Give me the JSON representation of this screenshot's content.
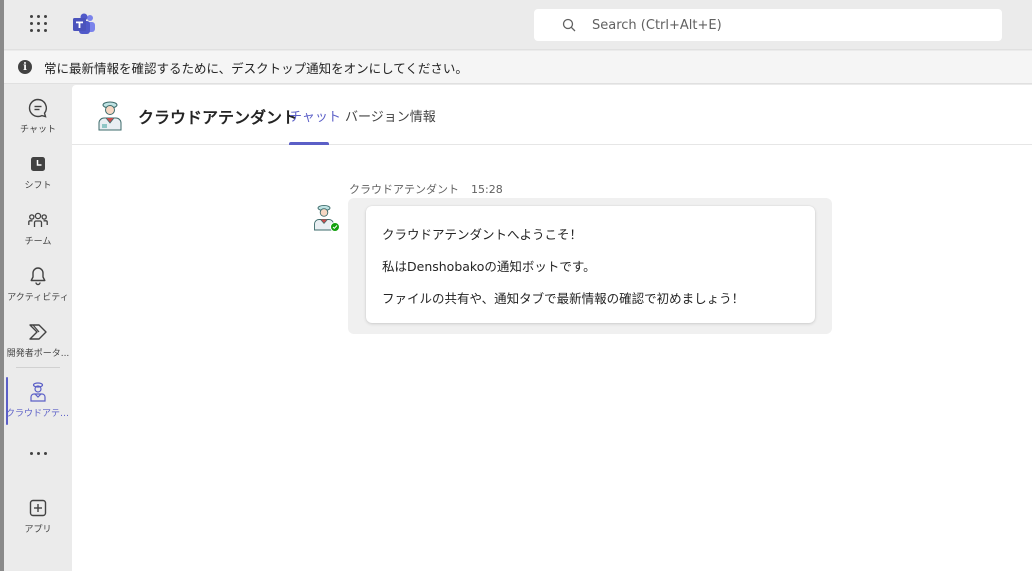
{
  "search": {
    "placeholder": "Search (Ctrl+Alt+E)"
  },
  "notification": {
    "text": "常に最新情報を確認するために、デスクトップ通知をオンにしてください。"
  },
  "rail": {
    "items": [
      {
        "label": "チャット",
        "icon": "chat-icon"
      },
      {
        "label": "シフト",
        "icon": "shifts-icon"
      },
      {
        "label": "チーム",
        "icon": "teams-icon"
      },
      {
        "label": "アクティビティ",
        "icon": "bell-icon"
      },
      {
        "label": "開発者ポータ...",
        "icon": "developer-portal-icon"
      },
      {
        "label": "クラウドアテン...",
        "icon": "bot-icon"
      },
      {
        "label": "アプリ",
        "icon": "add-apps-icon"
      }
    ]
  },
  "app": {
    "title": "クラウドアテンダント",
    "tabs": [
      {
        "label": "チャット",
        "active": true
      },
      {
        "label": "バージョン情報",
        "active": false
      }
    ]
  },
  "message": {
    "sender": "クラウドアテンダント",
    "time": "15:28",
    "lines": [
      "クラウドアテンダントへようこそ！",
      "私はDenshobakoの通知ボットです。",
      "ファイルの共有や、通知タブで最新情報の確認で初めましょう！"
    ]
  },
  "colors": {
    "accent": "#5b5fc7",
    "presence": "#13a10e"
  }
}
